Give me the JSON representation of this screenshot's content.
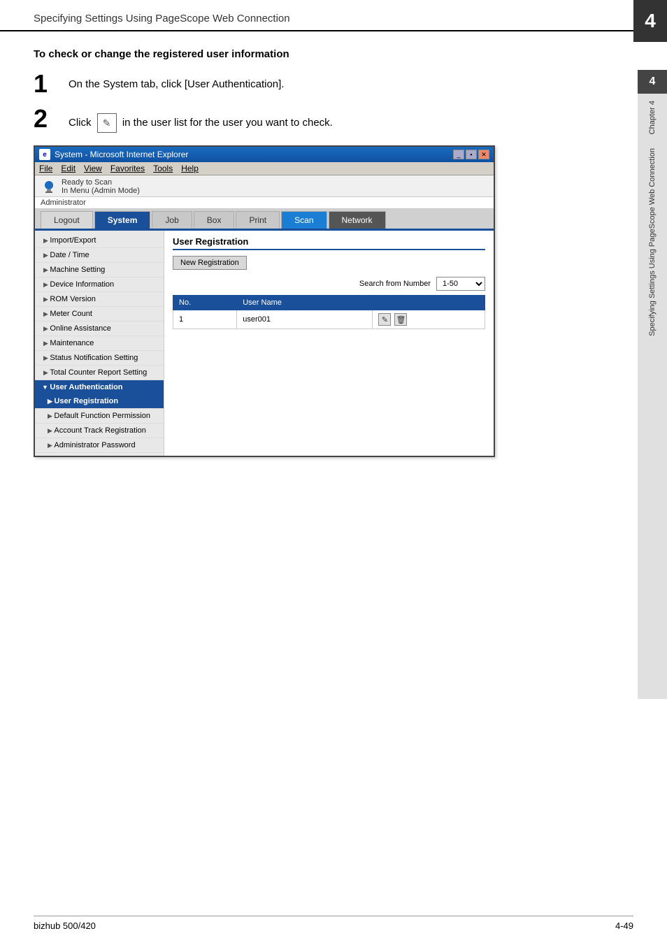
{
  "header": {
    "title": "Specifying Settings Using PageScope Web Connection",
    "page_number": "4"
  },
  "section": {
    "title": "To check or change the registered user information",
    "steps": [
      {
        "number": "1",
        "text": "On the System tab, click [User Authentication]."
      },
      {
        "number": "2",
        "text_before": "Click",
        "text_after": "in the user list for the user you want to check."
      }
    ]
  },
  "browser": {
    "title": "System - Microsoft Internet Explorer",
    "menu_items": [
      "File",
      "Edit",
      "View",
      "Favorites",
      "Tools",
      "Help"
    ],
    "status": {
      "line1": "Ready to Scan",
      "line2": "In Menu (Admin Mode)"
    },
    "admin_label": "Administrator",
    "tabs": [
      "Logout",
      "System",
      "Job",
      "Box",
      "Print",
      "Scan",
      "Network"
    ],
    "sidebar": {
      "items": [
        {
          "label": "Import/Export",
          "active": false
        },
        {
          "label": "Date / Time",
          "active": false
        },
        {
          "label": "Machine Setting",
          "active": false
        },
        {
          "label": "Device Information",
          "active": false
        },
        {
          "label": "ROM Version",
          "active": false
        },
        {
          "label": "Meter Count",
          "active": false
        },
        {
          "label": "Online Assistance",
          "active": false
        },
        {
          "label": "Maintenance",
          "active": false
        },
        {
          "label": "Status Notification Setting",
          "active": false
        },
        {
          "label": "Total Counter Report Setting",
          "active": false
        }
      ],
      "sections": [
        {
          "label": "User Authentication",
          "subitems": [
            {
              "label": "User Registration",
              "active": true
            },
            {
              "label": "Default Function Permission",
              "active": false
            },
            {
              "label": "Account Track Registration",
              "active": false
            },
            {
              "label": "Administrator Password",
              "active": false
            }
          ]
        }
      ]
    },
    "content": {
      "title": "User Registration",
      "new_registration_btn": "New Registration",
      "search_label": "Search from Number",
      "search_value": "1-50",
      "table": {
        "columns": [
          "No.",
          "User Name"
        ],
        "rows": [
          {
            "no": "1",
            "username": "user001"
          }
        ]
      }
    }
  },
  "right_sidebar": {
    "chapter_label": "Chapter 4",
    "vertical_text": "Specifying Settings Using PageScope Web Connection"
  },
  "footer": {
    "model": "bizhub 500/420",
    "page": "4-49"
  }
}
